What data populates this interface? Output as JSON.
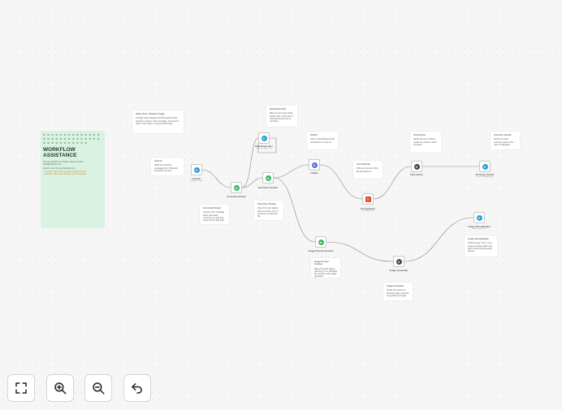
{
  "sticky": {
    "bars": "= = = = = = = = = = = = = = = = = = = = = = = = = = = = = = = = = = = = = = =",
    "title": "WORKFLOW ASSISTANCE",
    "lines": [
      "For any questions or support, please contact:",
      "hello@example.com",
      "Explore more tips and tutorials here:",
      "- YouTube: https://www.youtube.com/@example",
      "- LinkedIn: https://www.linkedin.com/in/example/"
    ]
  },
  "notes": [
    {
      "id": "n1",
      "title": "Sticky Note: Telegram trigger",
      "text": "A single node Telegram bot that parses what, receives a chat or voice message, and returns either a text reply or a generated image."
    },
    {
      "id": "n2",
      "title": "Listener",
      "text": "Waits for incoming messages from Telegram and starts the flow."
    },
    {
      "id": "n3",
      "title": "Help Responder",
      "text": "When a user types /start, replies with a short list of commands and how to use them."
    },
    {
      "id": "n4",
      "title": "Outline",
      "text": "Gets or downloads the file and passes it to the AI."
    },
    {
      "id": "n5",
      "title": "Text Extractor",
      "text": "Pulls out the text of the file and stores it."
    },
    {
      "id": "n6",
      "title": "Summariser",
      "text": "Sends the text to the AI model to produce a short summary."
    },
    {
      "id": "n7",
      "title": "Summary Sender",
      "text": "Sends the short summary back to the user on Telegram."
    },
    {
      "id": "n8",
      "title": "Command Router",
      "text": "Checks if the message starts with /start, /summary or /img and routes to the right path."
    },
    {
      "id": "n9",
      "title": "Summary Checker",
      "text": "Sees if the text begins with /summary. If so, it moves on to fetch the file."
    },
    {
      "id": "n10",
      "title": "Image Prompt Checker",
      "text": "Sees if the text begins with /img. If so, forwards the prompt to the image generator."
    },
    {
      "id": "n11",
      "title": "Image Generator",
      "text": "Sends the prompt to OpenAI image endpoint to get back an image."
    },
    {
      "id": "n12",
      "title": "Image Acknowledger",
      "text": "Tells the user \"Got it, your image is being made\" and then sends the generated picture."
    }
  ],
  "nodes": [
    {
      "id": "listener",
      "label": "Listener",
      "sub": "Telegram Trigger",
      "icon": "telegram-icon",
      "color": "#2aa1d8"
    },
    {
      "id": "command",
      "label": "Command Router",
      "sub": "",
      "icon": "switch-icon",
      "color": "#3cb55a"
    },
    {
      "id": "help",
      "label": "Help Responder",
      "sub": "send: sendMessage",
      "icon": "telegram-icon",
      "color": "#2aa1d8"
    },
    {
      "id": "summary_checker",
      "label": "Summary Checker",
      "sub": "",
      "icon": "switch-icon",
      "color": "#3cb55a"
    },
    {
      "id": "outline",
      "label": "Outline",
      "sub": "",
      "icon": "gear-icon",
      "color": "#4a6ed8"
    },
    {
      "id": "text_extractor",
      "label": "Text Extractor",
      "sub": "extractFromFile",
      "icon": "html5-icon",
      "color": "#e34f26"
    },
    {
      "id": "summariser",
      "label": "Summariser",
      "sub": "",
      "icon": "openai-icon",
      "color": "#444444"
    },
    {
      "id": "summary_sender",
      "label": "Summary Sender",
      "sub": "send: sendMessage",
      "icon": "telegram-icon",
      "color": "#2aa1d8"
    },
    {
      "id": "image_prompt",
      "label": "Image Prompt Checker",
      "sub": "",
      "icon": "switch-icon",
      "color": "#3cb55a"
    },
    {
      "id": "image_gen",
      "label": "Image Generator",
      "sub": "",
      "icon": "openai-icon",
      "color": "#444444"
    },
    {
      "id": "image_ack",
      "label": "Image Acknowledger",
      "sub": "send: sendPhoto",
      "icon": "telegram-icon",
      "color": "#2aa1d8"
    }
  ],
  "controls": [
    {
      "id": "fit",
      "name": "fit-view-button"
    },
    {
      "id": "zoomin",
      "name": "zoom-in-button"
    },
    {
      "id": "zoomout",
      "name": "zoom-out-button"
    },
    {
      "id": "undo",
      "name": "undo-button"
    }
  ]
}
